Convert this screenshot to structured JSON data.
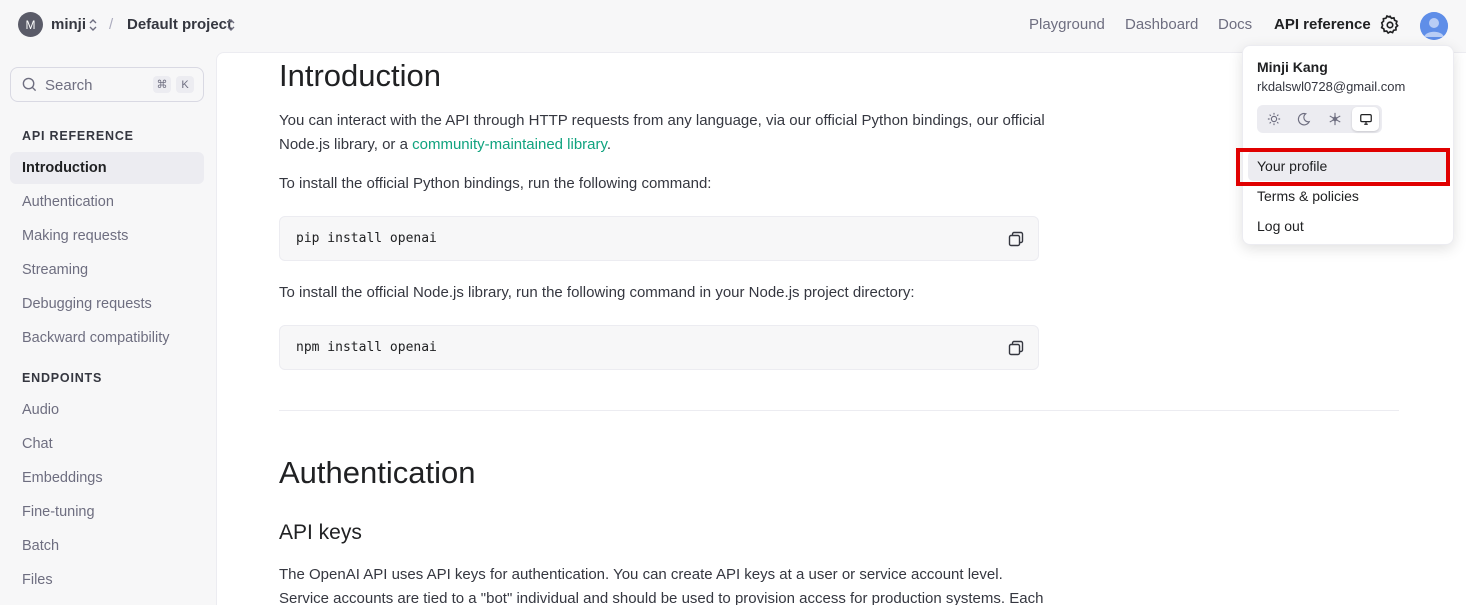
{
  "topbar": {
    "org_initial": "M",
    "org_name": "minji",
    "separator": "/",
    "project_name": "Default project",
    "nav": [
      "Playground",
      "Dashboard",
      "Docs",
      "API reference"
    ],
    "active_nav": "API reference"
  },
  "sidebar": {
    "search_placeholder": "Search",
    "shortcut_keys": [
      "⌘",
      "K"
    ],
    "sections": [
      {
        "heading": "API REFERENCE",
        "items": [
          "Introduction",
          "Authentication",
          "Making requests",
          "Streaming",
          "Debugging requests",
          "Backward compatibility"
        ]
      },
      {
        "heading": "ENDPOINTS",
        "items": [
          "Audio",
          "Chat",
          "Embeddings",
          "Fine-tuning",
          "Batch",
          "Files"
        ]
      }
    ],
    "active_item": "Introduction"
  },
  "main": {
    "intro_title": "Introduction",
    "intro_text_before_link": "You can interact with the API through HTTP requests from any language, via our official Python bindings, our official Node.js library, or a ",
    "intro_link": "community-maintained library",
    "intro_text_after_link": ".",
    "python_text": "To install the official Python bindings, run the following command:",
    "python_cmd": "pip install openai",
    "node_text": "To install the official Node.js library, run the following command in your Node.js project directory:",
    "node_cmd": "npm install openai",
    "auth_title": "Authentication",
    "api_keys_title": "API keys",
    "api_keys_text": "The OpenAI API uses API keys for authentication. You can create API keys at a user or service account level. Service accounts are tied to a \"bot\" individual and should be used to provision access for production systems. Each"
  },
  "dropdown": {
    "name": "Minji Kang",
    "email": "rkdalswl0728@gmail.com",
    "theme_options": [
      "light-icon",
      "dark-icon",
      "system-snowflake-icon",
      "monitor-icon"
    ],
    "selected_theme": "monitor-icon",
    "items": [
      "Your profile",
      "Terms & policies",
      "Log out"
    ],
    "highlighted_item": "Your profile"
  },
  "colors": {
    "link": "#10a37f",
    "highlight_border": "#e00000",
    "avatar_bg": "#5f8ee8"
  }
}
